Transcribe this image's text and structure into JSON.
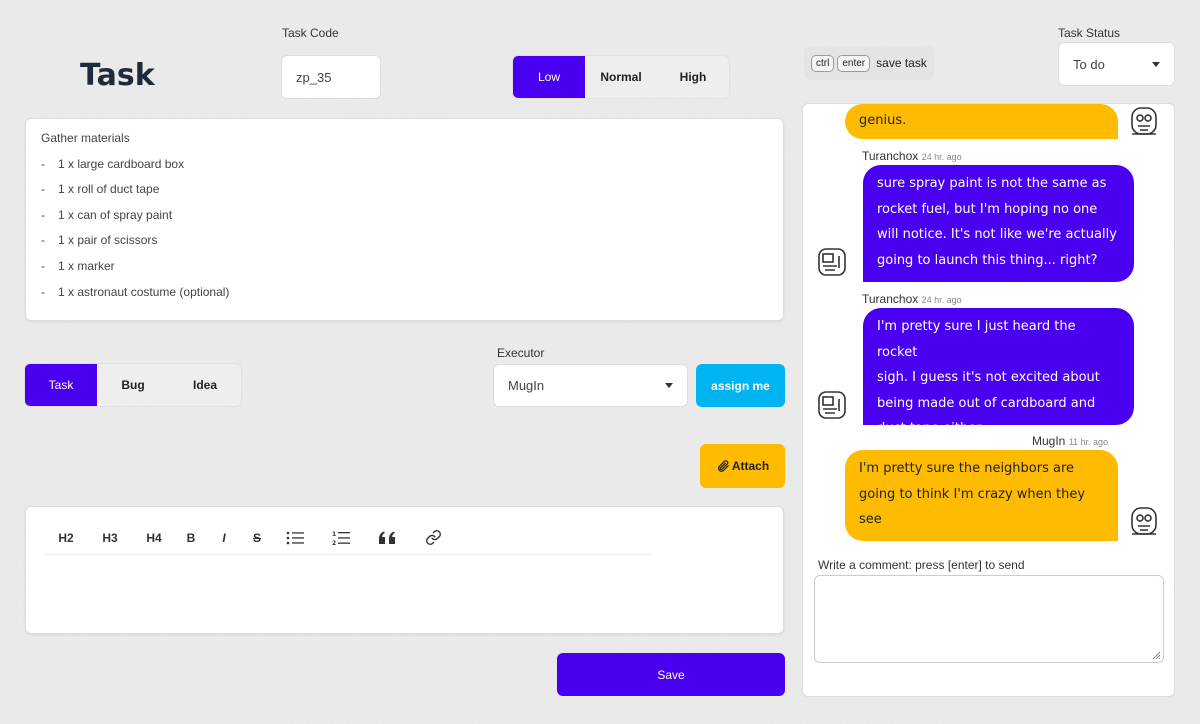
{
  "page": {
    "title": "Task"
  },
  "task_code": {
    "label": "Task Code",
    "value": "zp_35"
  },
  "priority": {
    "options": [
      "Low",
      "Normal",
      "High"
    ],
    "selected": "Low"
  },
  "description": {
    "heading": "Gather materials",
    "items": [
      "1 x large cardboard box",
      "1 x roll of duct tape",
      "1 x can of spray paint",
      "1 x pair of scissors",
      "1 x marker",
      "1 x astronaut costume (optional)"
    ]
  },
  "task_type": {
    "options": [
      "Task",
      "Bug",
      "Idea"
    ],
    "selected": "Task"
  },
  "executor": {
    "label": "Executor",
    "value": "MugIn"
  },
  "assign_button": "assign me",
  "attach_button": "Attach",
  "editor_toolbar": {
    "h2": "H2",
    "h3": "H3",
    "h4": "H4",
    "bold": "B",
    "italic": "I",
    "strike": "S"
  },
  "save_button": "Save",
  "shortcut_hint": {
    "key1": "ctrl",
    "key2": "enter",
    "text": "save task"
  },
  "task_status": {
    "label": "Task Status",
    "value": "To do"
  },
  "comments": [
    {
      "text": "genius."
    },
    {
      "author": "Turanchox",
      "ago": "24 hr. ago",
      "lines": [
        "sure spray paint is not the same as",
        "rocket fuel, but I'm hoping no one",
        "will notice. It's not like we're actually",
        "going to launch this thing... right?"
      ]
    },
    {
      "author": "Turanchox",
      "ago": "24 hr. ago",
      "lines": [
        "I'm pretty sure I just heard the rocket",
        "sigh. I guess it's not excited about",
        "being made out of cardboard and",
        "duct tape either."
      ]
    },
    {
      "author": "MugIn",
      "ago": "11 hr. ago",
      "lines": [
        "I'm pretty sure the neighbors are",
        "going to think I'm crazy when they",
        "see"
      ]
    }
  ],
  "comment_input": {
    "label": "Write a comment: press [enter] to send",
    "value": ""
  },
  "colors": {
    "primary": "#4a00f0",
    "accent_yellow": "#ffbb00",
    "accent_blue": "#00b4f0"
  }
}
